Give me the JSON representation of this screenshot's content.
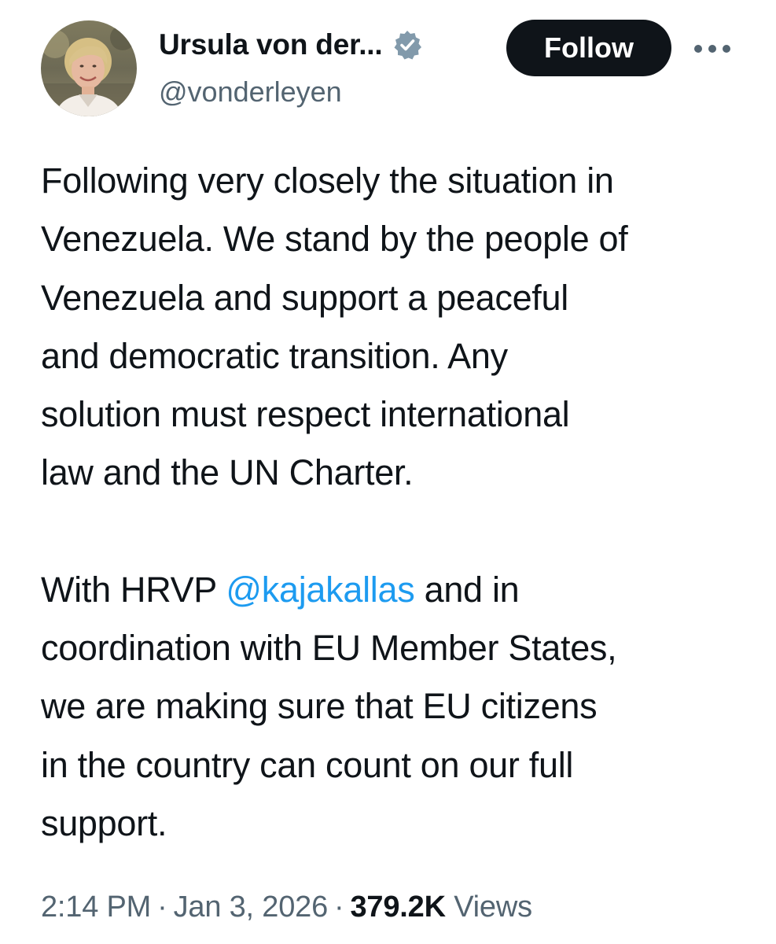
{
  "author": {
    "display_name": "Ursula von der...",
    "handle": "@vonderleyen",
    "verified": true,
    "avatar_icon": "profile-photo-avatar"
  },
  "actions": {
    "follow_label": "Follow",
    "more_icon": "ellipsis-icon"
  },
  "tweet": {
    "paragraph1_lines": [
      "Following very closely the situation in",
      "Venezuela. We stand by the people of",
      "Venezuela and support a peaceful",
      "and democratic transition. Any",
      "solution must respect international",
      "law and the UN Charter."
    ],
    "paragraph2": {
      "prefix": "With HRVP ",
      "mention": "@kajakallas",
      "suffix_first_line": " and in",
      "lines": [
        "coordination with EU Member States,",
        "we are making sure that EU citizens",
        "in the country can count on our full",
        "support."
      ]
    }
  },
  "meta": {
    "time": "2:14 PM",
    "separator": "·",
    "date": "Jan 3, 2026",
    "views_count": "379.2K",
    "views_label": "Views"
  },
  "colors": {
    "text": "#0f1419",
    "secondary": "#536471",
    "link": "#1d9bf0",
    "verified_badge": "#829aab",
    "follow_bg": "#0f1419"
  }
}
